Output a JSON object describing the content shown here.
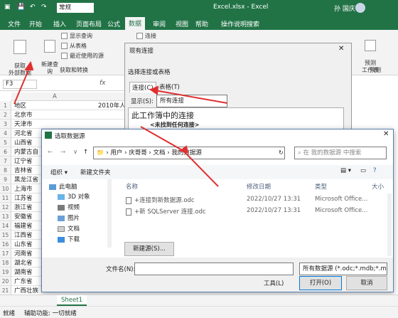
{
  "titlebar": {
    "filename": "Excel.xlsx - Excel",
    "user": "孙 国庆",
    "quick_mode": "常规"
  },
  "ribbon_tabs": [
    "文件",
    "开始",
    "插入",
    "页面布局",
    "公式",
    "数据",
    "审阅",
    "视图",
    "帮助",
    "操作说明搜索"
  ],
  "ribbon": {
    "get_external": "获取\n外部数据",
    "new_query": "新建查\n询",
    "show_query": "显示查询",
    "from_table": "从表格",
    "recent_sources": "最近使用的源",
    "group_label": "获取和转换",
    "connections": "连接",
    "predict": "预测\n工作表",
    "predict_group": "预测"
  },
  "formula": {
    "namebox": "F3",
    "fx": "fx"
  },
  "sheet": {
    "col_a": "A",
    "header_a1": "地区",
    "header_b1": "2010年人",
    "rows": [
      "北京市",
      "天津市",
      "河北省",
      "山西省",
      "内蒙古自",
      "辽宁省",
      "吉林省",
      "黑龙江省",
      "上海市",
      "江苏省",
      "浙江省",
      "安徽省",
      "福建省",
      "江西省",
      "山东省",
      "河南省",
      "湖北省",
      "湖南省",
      "广东省",
      "广西壮族",
      "海南省"
    ],
    "row_numbers": [
      "1",
      "2",
      "3",
      "4",
      "5",
      "6",
      "7",
      "8",
      "9",
      "10",
      "11",
      "12",
      "13",
      "14",
      "15",
      "16",
      "17",
      "18",
      "19",
      "20",
      "21",
      "22"
    ]
  },
  "conn_dialog": {
    "title": "现有连接",
    "prompt": "选择连接或表格",
    "tab_conn": "连接(C)",
    "tab_table": "表格(T)",
    "show_label": "显示(S):",
    "show_value": "所有连接",
    "heading": "此工作簿中的连接",
    "none": "<未找到任何连接>"
  },
  "file_dialog": {
    "title": "选取数据源",
    "breadcrumb": [
      "用户",
      "庆哥哥",
      "文档",
      "我的数据源"
    ],
    "search_placeholder": "在 我的数据源 中搜索",
    "organize": "组织 ▾",
    "new_folder": "新建文件夹",
    "nav": [
      "此电脑",
      "3D 对象",
      "视频",
      "图片",
      "文档",
      "下载"
    ],
    "columns": {
      "name": "名称",
      "date": "修改日期",
      "type": "类型",
      "size": "大小"
    },
    "files": [
      {
        "name": "+连接到新数据源.odc",
        "date": "2022/10/27 13:31",
        "type": "Microsoft Office..."
      },
      {
        "name": "+新 SQLServer 连接.odc",
        "date": "2022/10/27 13:31",
        "type": "Microsoft Office..."
      }
    ],
    "new_source": "新建源(S)...",
    "filename_label": "文件名(N):",
    "filter": "所有数据源 (*.odc;*.mdb;*.mc",
    "tools": "工具(L)",
    "open": "打开(O)",
    "cancel": "取消"
  },
  "sheet_tab": "Sheet1",
  "status": {
    "ready": "就绪",
    "accessibility": "辅助功能: 一切就绪"
  },
  "colors": {
    "excel_green": "#217346",
    "arrow_red": "#e03030"
  }
}
